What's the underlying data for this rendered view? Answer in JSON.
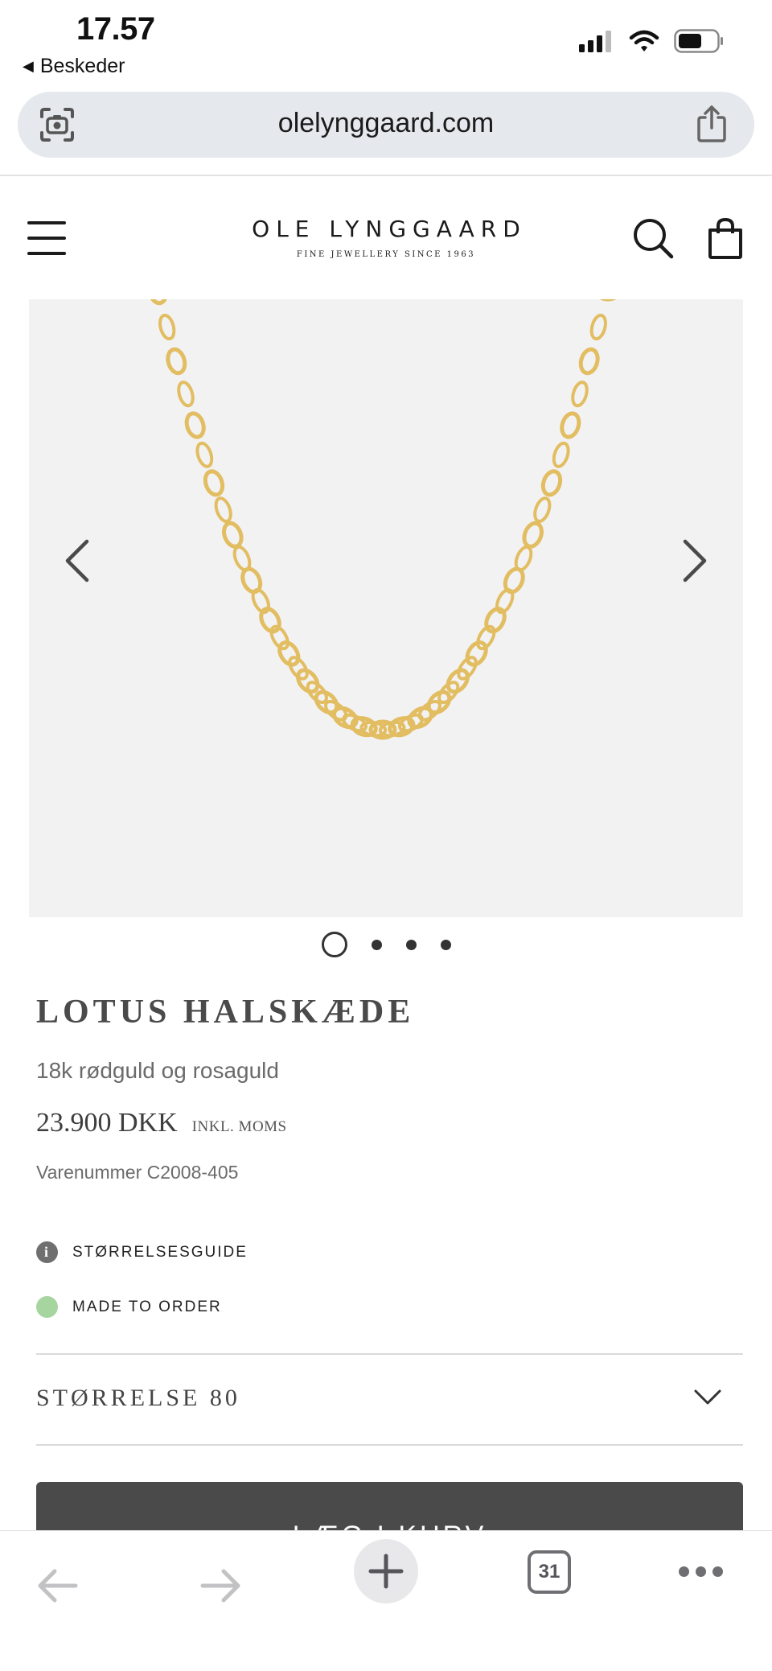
{
  "status_bar": {
    "time": "17.57",
    "back_label": "Beskeder"
  },
  "browser": {
    "url": "olelynggaard.com",
    "tab_count": "31"
  },
  "site": {
    "logo_main": "OLE LYNGGAARD",
    "logo_tagline": "FINE JEWELLERY SINCE 1963"
  },
  "gallery": {
    "image_count": 4,
    "active_index": 0
  },
  "product": {
    "title": "LOTUS HALSKÆDE",
    "material": "18k rødguld og rosaguld",
    "price": "23.900 DKK",
    "price_note": "INKL. MOMS",
    "sku": "Varenummer C2008-405",
    "size_guide_label": "STØRRELSESGUIDE",
    "availability_label": "MADE TO ORDER",
    "size_label": "STØRRELSE 80",
    "add_to_cart_label": "LÆG I KURV"
  },
  "colors": {
    "background": "#ffffff",
    "gallery_bg": "#f2f2f2",
    "chain_gold": "#e2bd61",
    "button_bg": "#4a4a4a",
    "availability_dot": "#a7d5a0"
  },
  "icons": {
    "status": [
      "signal-icon",
      "wifi-icon",
      "battery-icon"
    ],
    "header": [
      "menu-icon",
      "search-icon",
      "bag-icon"
    ],
    "toolbar": [
      "back-icon",
      "forward-icon",
      "new-tab-icon",
      "tabs-icon",
      "more-icon"
    ]
  }
}
